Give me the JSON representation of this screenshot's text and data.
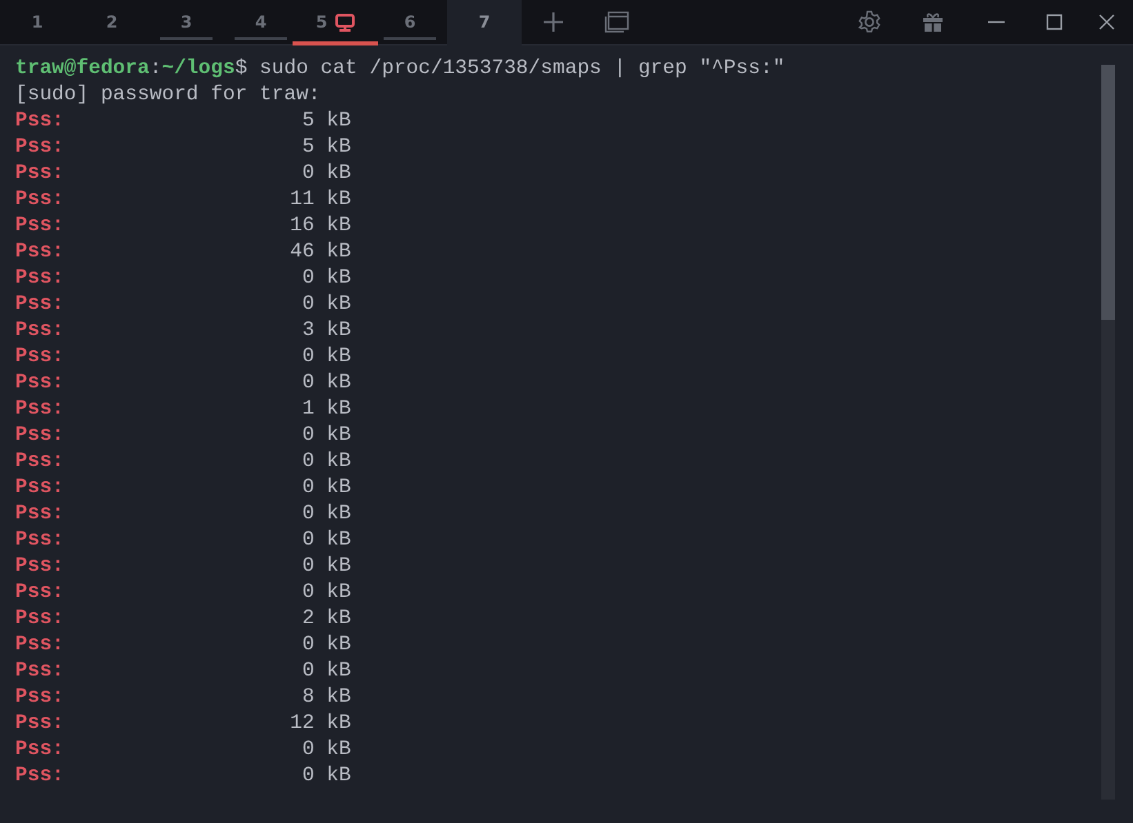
{
  "tabs": [
    {
      "label": "1",
      "selected": false,
      "activity": false,
      "alert": false,
      "monitor": false
    },
    {
      "label": "2",
      "selected": false,
      "activity": false,
      "alert": false,
      "monitor": false
    },
    {
      "label": "3",
      "selected": false,
      "activity": true,
      "alert": false,
      "monitor": false
    },
    {
      "label": "4",
      "selected": false,
      "activity": true,
      "alert": false,
      "monitor": false
    },
    {
      "label": "5",
      "selected": false,
      "activity": false,
      "alert": true,
      "monitor": true
    },
    {
      "label": "6",
      "selected": false,
      "activity": true,
      "alert": false,
      "monitor": false
    },
    {
      "label": "7",
      "selected": true,
      "activity": false,
      "alert": false,
      "monitor": false
    }
  ],
  "terminal": {
    "prompt": {
      "user_host": "traw@fedora",
      "separator": ":",
      "path": "~/logs",
      "symbol": "$",
      "command": " sudo cat /proc/1353738/smaps | grep \"^Pss:\""
    },
    "sudo_prompt": "[sudo] password for traw:",
    "rows": [
      {
        "key": "Pss:",
        "value": "5 kB"
      },
      {
        "key": "Pss:",
        "value": "5 kB"
      },
      {
        "key": "Pss:",
        "value": "0 kB"
      },
      {
        "key": "Pss:",
        "value": "11 kB"
      },
      {
        "key": "Pss:",
        "value": "16 kB"
      },
      {
        "key": "Pss:",
        "value": "46 kB"
      },
      {
        "key": "Pss:",
        "value": "0 kB"
      },
      {
        "key": "Pss:",
        "value": "0 kB"
      },
      {
        "key": "Pss:",
        "value": "3 kB"
      },
      {
        "key": "Pss:",
        "value": "0 kB"
      },
      {
        "key": "Pss:",
        "value": "0 kB"
      },
      {
        "key": "Pss:",
        "value": "1 kB"
      },
      {
        "key": "Pss:",
        "value": "0 kB"
      },
      {
        "key": "Pss:",
        "value": "0 kB"
      },
      {
        "key": "Pss:",
        "value": "0 kB"
      },
      {
        "key": "Pss:",
        "value": "0 kB"
      },
      {
        "key": "Pss:",
        "value": "0 kB"
      },
      {
        "key": "Pss:",
        "value": "0 kB"
      },
      {
        "key": "Pss:",
        "value": "0 kB"
      },
      {
        "key": "Pss:",
        "value": "2 kB"
      },
      {
        "key": "Pss:",
        "value": "0 kB"
      },
      {
        "key": "Pss:",
        "value": "0 kB"
      },
      {
        "key": "Pss:",
        "value": "8 kB"
      },
      {
        "key": "Pss:",
        "value": "12 kB"
      },
      {
        "key": "Pss:",
        "value": "0 kB"
      },
      {
        "key": "Pss:",
        "value": "0 kB"
      }
    ]
  }
}
